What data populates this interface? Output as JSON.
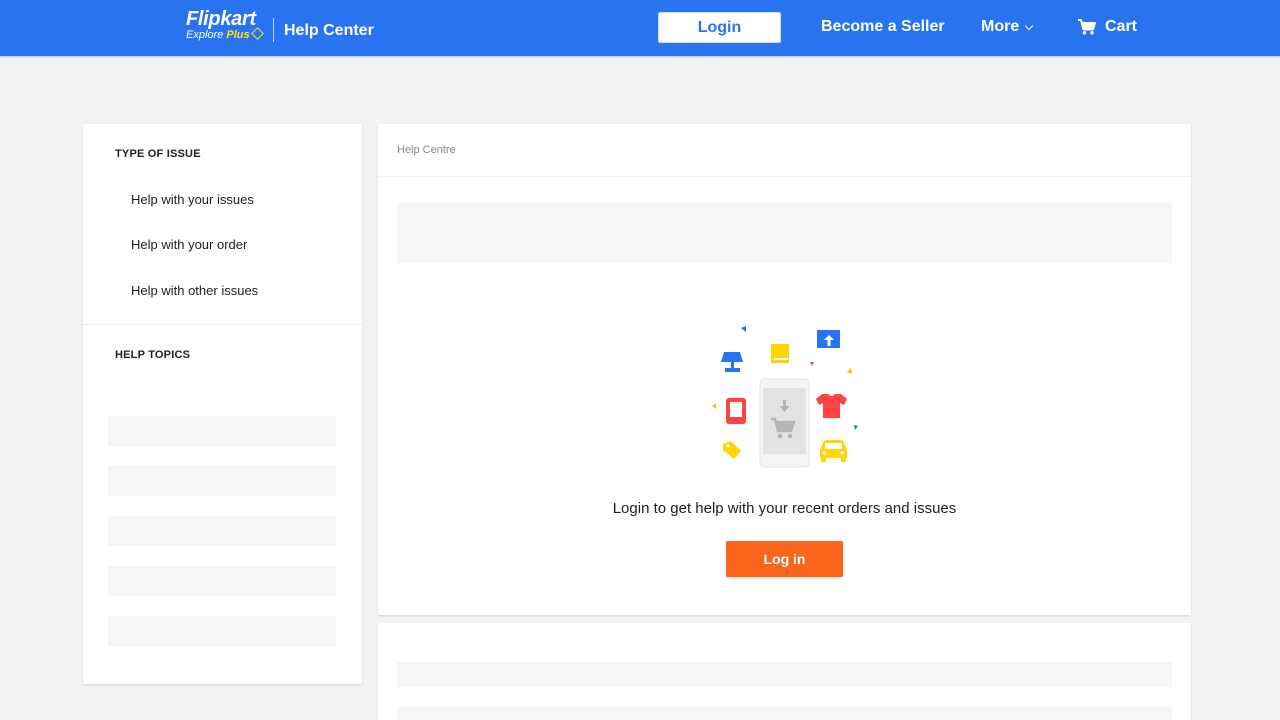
{
  "header": {
    "logo_text": "Flipkart",
    "logo_sub_explore": "Explore",
    "logo_sub_plus": "Plus",
    "title": "Help Center",
    "login_label": "Login",
    "seller_label": "Become a Seller",
    "more_label": "More",
    "cart_label": "Cart",
    "brand_color": "#2874f0",
    "accent_color": "#ffe500",
    "icons": [
      "plus-icon",
      "chevron-down-icon",
      "cart-icon"
    ]
  },
  "sidebar": {
    "type_heading": "TYPE OF ISSUE",
    "items": [
      {
        "label": "Help with your issues"
      },
      {
        "label": "Help with your order"
      },
      {
        "label": "Help with other issues"
      }
    ],
    "topics_heading": "HELP TOPICS"
  },
  "main": {
    "breadcrumb": "Help Centre",
    "prompt": "Login to get help with your recent orders and issues",
    "login_button": "Log in",
    "login_button_color": "#fb641b",
    "illustration_icons": [
      "lamp-icon",
      "book-icon",
      "upload-icon",
      "phone-icon",
      "tshirt-icon",
      "tag-icon",
      "car-icon",
      "cart-icon"
    ]
  }
}
